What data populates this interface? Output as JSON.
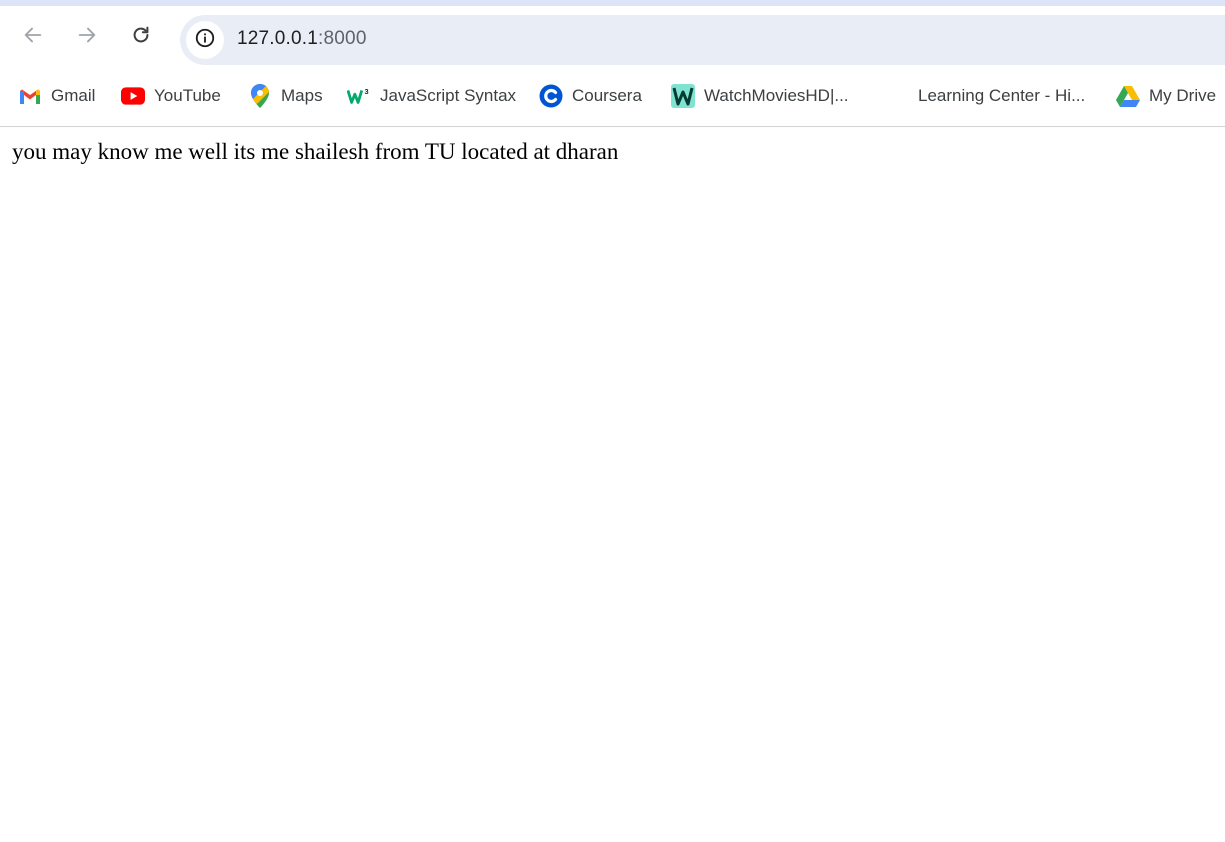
{
  "browser": {
    "nav": {
      "back_icon": "arrow-left-icon",
      "forward_icon": "arrow-right-icon",
      "reload_icon": "reload-icon"
    },
    "omnibox": {
      "info_icon": "info-icon",
      "host": "127.0.0.1",
      "port": ":8000"
    },
    "bookmarks": [
      {
        "label": "Gmail",
        "icon": "gmail-icon"
      },
      {
        "label": "YouTube",
        "icon": "youtube-icon"
      },
      {
        "label": "Maps",
        "icon": "maps-icon"
      },
      {
        "label": "JavaScript Syntax",
        "icon": "w3schools-icon"
      },
      {
        "label": "Coursera",
        "icon": "coursera-icon"
      },
      {
        "label": "WatchMoviesHD|...",
        "icon": "watchmovies-icon"
      },
      {
        "label": "Learning Center - Hi...",
        "icon": ""
      },
      {
        "label": "My Drive",
        "icon": "google-drive-icon"
      }
    ],
    "colors": {
      "top_strip": "#dbe5f7",
      "omnibox_bg": "#e9eef6"
    }
  },
  "page": {
    "body_text": "you may know me well its me shailesh from TU located at dharan"
  }
}
